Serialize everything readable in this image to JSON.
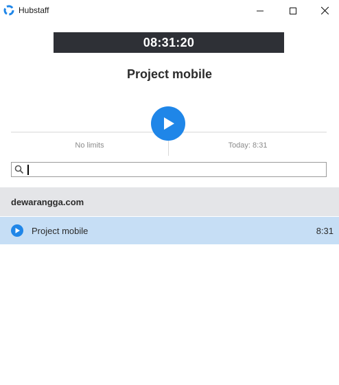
{
  "window": {
    "title": "Hubstaff",
    "logo_icon": "hubstaff-logo-icon",
    "controls": [
      "minimize-icon",
      "maximize-icon",
      "close-icon"
    ]
  },
  "timer": {
    "display": "08:31:20"
  },
  "current_project": {
    "name": "Project mobile"
  },
  "controls": {
    "play_icon": "play-icon",
    "accent_color": "#1f86e8"
  },
  "stats": {
    "limit": "No limits",
    "today": "Today: 8:31"
  },
  "search": {
    "value": "",
    "placeholder": "",
    "icon": "search-icon"
  },
  "organizations": [
    {
      "name": "dewarangga.com",
      "projects": [
        {
          "name": "Project mobile",
          "time": "8:31",
          "selected": true
        }
      ]
    }
  ]
}
